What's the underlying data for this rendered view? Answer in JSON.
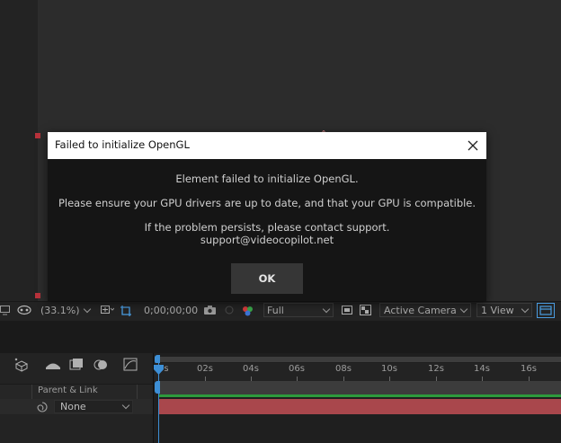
{
  "dialog": {
    "title": "Failed to initialize OpenGL",
    "message_line1": "Element failed to initialize OpenGL.",
    "message_line2": "Please ensure your GPU drivers are up to date, and that your GPU is compatible.",
    "message_line3": "If the problem persists, please contact support.",
    "support_email": "support@videocopilot.net",
    "ok_label": "OK"
  },
  "viewer_toolbar": {
    "zoom": "(33.1%)",
    "timecode": "0;00;00;00",
    "resolution": "Full",
    "camera": "Active Camera",
    "view_layout": "1 View"
  },
  "timeline": {
    "parent_link_header": "Parent & Link",
    "parent_value": "None",
    "ruler_labels": [
      "0s",
      "02s",
      "04s",
      "06s",
      "08s",
      "10s",
      "12s",
      "14s",
      "16s"
    ]
  },
  "colors": {
    "layer_bar": "#a9474c",
    "playhead": "#3d8fd6",
    "work_area_line": "#2d9a3c"
  }
}
